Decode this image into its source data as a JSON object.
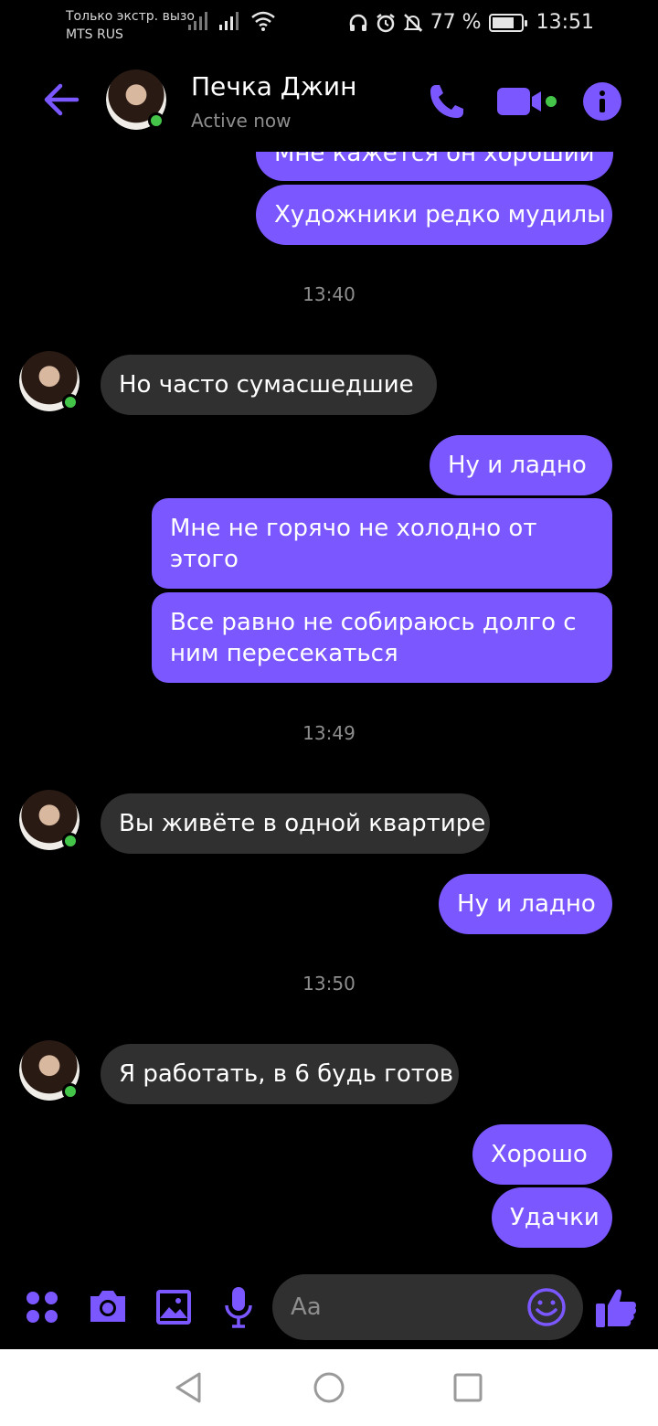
{
  "status_bar": {
    "carrier_line1": "Только экстр. вызо",
    "carrier_line2": "MTS RUS",
    "battery_percent": "77 %",
    "battery_level": 0.77,
    "time": "13:51"
  },
  "header": {
    "contact_name": "Печка Джин",
    "contact_status": "Active now"
  },
  "messages": {
    "m1": "Мне кажется он хороший",
    "m2": "Художники редко мудилы",
    "t1": "13:40",
    "m3": "Но часто сумасшедшие",
    "m4": "Ну и ладно",
    "m5": "Мне не горячо не холодно от этого",
    "m6": "Все равно не собираюсь долго с ним пересекаться",
    "t2": "13:49",
    "m7": "Вы живёте в одной квартире",
    "m8": "Ну и ладно",
    "t3": "13:50",
    "m9": "Я работать, в 6 будь готов",
    "m10": "Хорошо",
    "m11": "Удачки"
  },
  "composer": {
    "placeholder": "Aa"
  },
  "colors": {
    "accent": "#7b57ff",
    "incoming_bubble": "#303030",
    "online": "#44c549"
  },
  "icons": [
    "back-arrow-icon",
    "phone-icon",
    "video-camera-icon",
    "info-icon",
    "apps-icon",
    "camera-icon",
    "gallery-icon",
    "microphone-icon",
    "emoji-icon",
    "thumbs-up-icon",
    "nav-back-icon",
    "nav-home-icon",
    "nav-recents-icon"
  ]
}
